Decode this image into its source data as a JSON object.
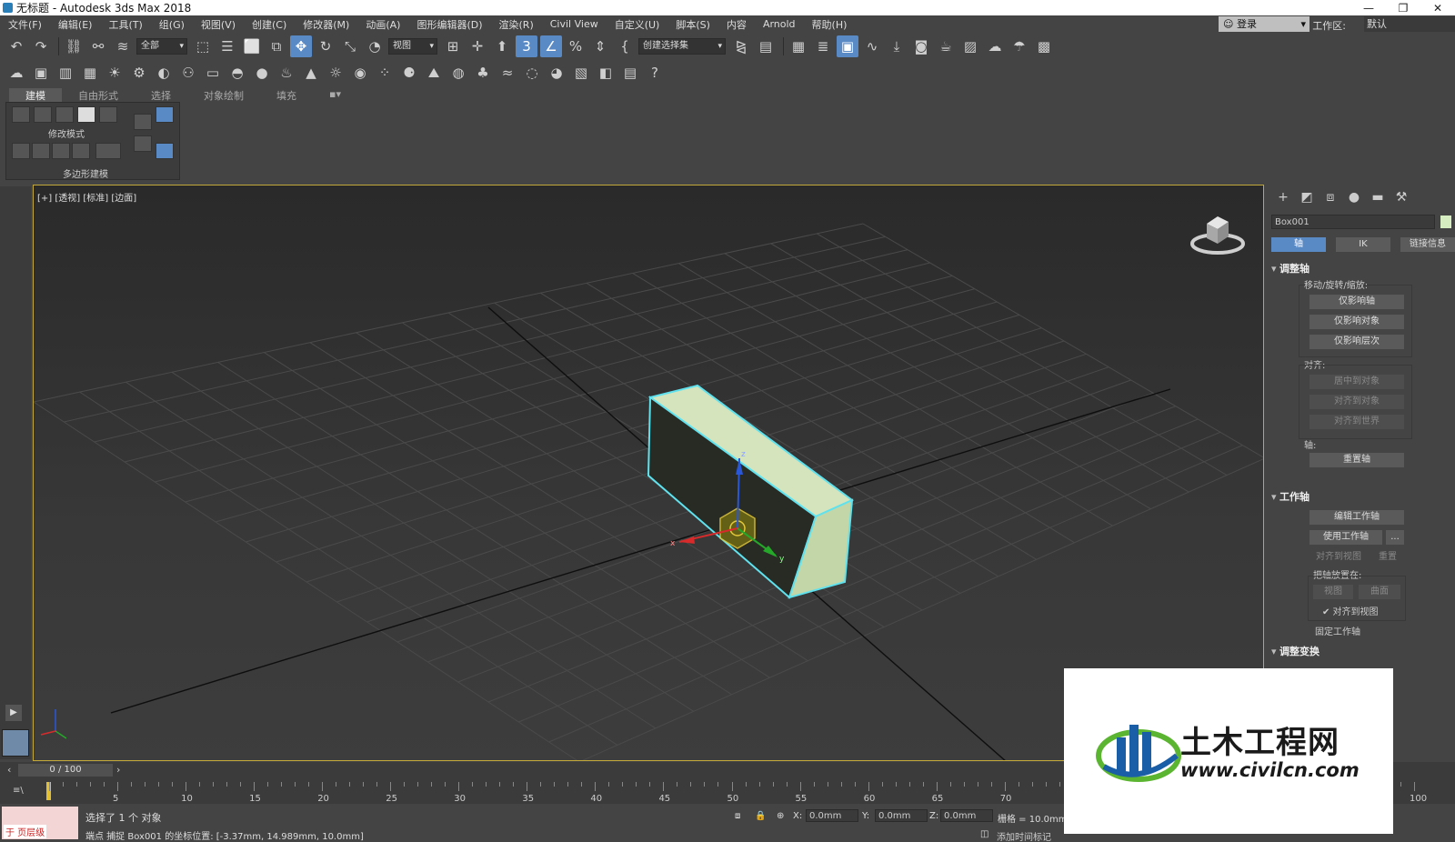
{
  "window": {
    "title": "无标题 - Autodesk 3ds Max 2018",
    "controls": [
      "—",
      "❐",
      "✕"
    ]
  },
  "menu": [
    "文件(F)",
    "编辑(E)",
    "工具(T)",
    "组(G)",
    "视图(V)",
    "创建(C)",
    "修改器(M)",
    "动画(A)",
    "图形编辑器(D)",
    "渲染(R)",
    "Civil View",
    "自定义(U)",
    "脚本(S)",
    "内容",
    "Arnold",
    "帮助(H)"
  ],
  "account": {
    "login": "登录",
    "workspace_label": "工作区:",
    "workspace_value": "默认"
  },
  "toolbar": {
    "selection_filter": "全部",
    "ref_coord": "视图",
    "named_selection": "创建选择集"
  },
  "ribbon": {
    "tabs": [
      "建模",
      "自由形式",
      "选择",
      "对象绘制",
      "填充"
    ],
    "active_tab": "建模",
    "modify_mode": "修改模式",
    "poly_modeling": "多边形建模"
  },
  "viewport": {
    "label": "[+] [透视] [标准] [边面]",
    "axis_x": "x",
    "axis_y": "y",
    "axis_z": "z"
  },
  "command_panel": {
    "object_name": "Box001",
    "object_color": "#d6edc2",
    "subtabs": [
      "轴",
      "IK",
      "链接信息"
    ],
    "active_subtab": "轴",
    "adjust_pivot": {
      "title": "调整轴",
      "move_rotate_scale": "移动/旋转/缩放:",
      "affect_pivot_only": "仅影响轴",
      "affect_object_only": "仅影响对象",
      "affect_hierarchy_only": "仅影响层次",
      "align_label": "对齐:",
      "center_to_object": "居中到对象",
      "align_to_object": "对齐到对象",
      "align_to_world": "对齐到世界",
      "pivot_label": "轴:",
      "reset_pivot": "重置轴"
    },
    "working_pivot": {
      "title": "工作轴",
      "edit_working_pivot": "编辑工作轴",
      "use_working_pivot": "使用工作轴",
      "more": "...",
      "align_to_view": "对齐到视图",
      "reset": "重置",
      "place_pivot_to": "把轴放置在:",
      "view": "视图",
      "surface": "曲面",
      "align_to_view_check": "✔ 对齐到视图",
      "lock_working_pivot": "固定工作轴"
    },
    "adjust_transform": {
      "title": "调整变换"
    }
  },
  "timeline": {
    "slider": "0 / 100",
    "ticks": [
      "5",
      "10",
      "15",
      "20",
      "25",
      "30",
      "35",
      "40",
      "45",
      "50",
      "55",
      "60",
      "65",
      "70",
      "100"
    ],
    "icon": "≡\\"
  },
  "status": {
    "maxscript": "于 页层级",
    "selection_msg": "选择了 1 个 对象",
    "prompt_msg": "端点 捕捉 Box001 的坐标位置: [-3.37mm, 14.989mm, 10.0mm]",
    "x_label": "X:",
    "x_value": "0.0mm",
    "y_label": "Y:",
    "y_value": "0.0mm",
    "z_label": "Z:",
    "z_value": "0.0mm",
    "grid": "栅格 = 10.0mm",
    "add_time_tag": "添加时间标记"
  },
  "watermark": {
    "brand": "土木工程网",
    "url": "www.civilcn.com",
    "blue": "#1a5ea8",
    "green": "#5cb531"
  }
}
